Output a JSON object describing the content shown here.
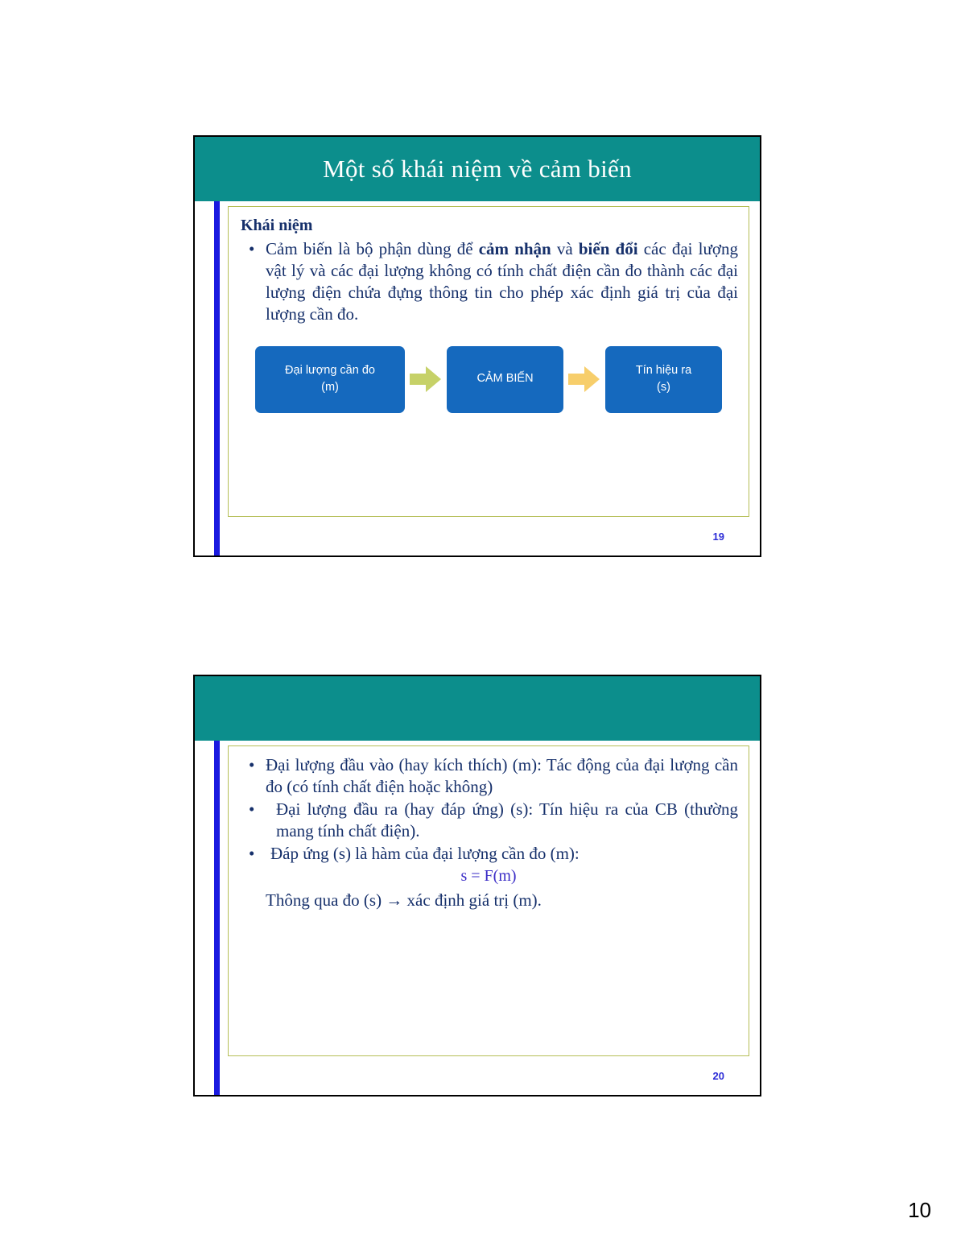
{
  "document": {
    "page_number": "10"
  },
  "slides": [
    {
      "title": "Một số khái niệm về cảm biến",
      "heading": "Khái niệm",
      "bullets": [
        {
          "marker": "•",
          "parts": [
            {
              "text": "Cảm biến là bộ phận dùng để ",
              "bold": false
            },
            {
              "text": "cảm nhận",
              "bold": true
            },
            {
              "text": " và ",
              "bold": false
            },
            {
              "text": "biến đổi",
              "bold": true
            },
            {
              "text": " các đại lượng vật lý và các đại lượng không có tính chất điện cần đo thành các đại lượng điện chứa đựng thông tin cho phép  xác định giá trị của đại lượng cần đo.",
              "bold": false
            }
          ]
        }
      ],
      "diagram": {
        "type": "flow",
        "nodes": [
          {
            "line1": "Đại lượng cần đo",
            "line2": "(m)"
          },
          {
            "line1": "CẢM BIẾN",
            "line2": ""
          },
          {
            "line1": "Tín hiệu ra",
            "line2": "(s)"
          }
        ],
        "arrows": [
          {
            "name": "arrow-right-icon",
            "color": "#C6D168"
          },
          {
            "name": "arrow-right-icon",
            "color": "#F7CE6B"
          }
        ],
        "node_color": "#1569BE",
        "node_text_color": "#FFFFFF"
      },
      "number": "19"
    },
    {
      "title": "",
      "heading": "",
      "bullets": [
        {
          "marker": "•",
          "parts": [
            {
              "text": "Đại lượng đầu vào (hay kích thích) (m): Tác động của đại lượng cần đo (có tính chất điện hoặc không)",
              "bold": false
            }
          ]
        },
        {
          "marker": "•",
          "parts": [
            {
              "text": " Đại lượng đầu ra (hay đáp ứng) (s): Tín hiệu ra của CB (thường mang tính chất điện).",
              "bold": false
            }
          ]
        },
        {
          "marker": "•",
          "parts": [
            {
              "text": " Đáp ứng (s) là hàm của đại lượng cần đo (m):",
              "bold": false
            }
          ]
        }
      ],
      "formula": "s = F(m)",
      "closing_line": "Thông qua đo (s) → xác định giá trị (m).",
      "number": "20"
    }
  ],
  "colors": {
    "title_band": "#0C8E8C",
    "accent_bar": "#1A1AE0",
    "content_border": "#B5BE56",
    "body_text": "#16306B",
    "formula_text": "#3A2CC6",
    "slide_number": "#2B2BD6",
    "flow_node": "#1569BE",
    "arrow_1": "#C6D168",
    "arrow_2": "#F7CE6B"
  }
}
